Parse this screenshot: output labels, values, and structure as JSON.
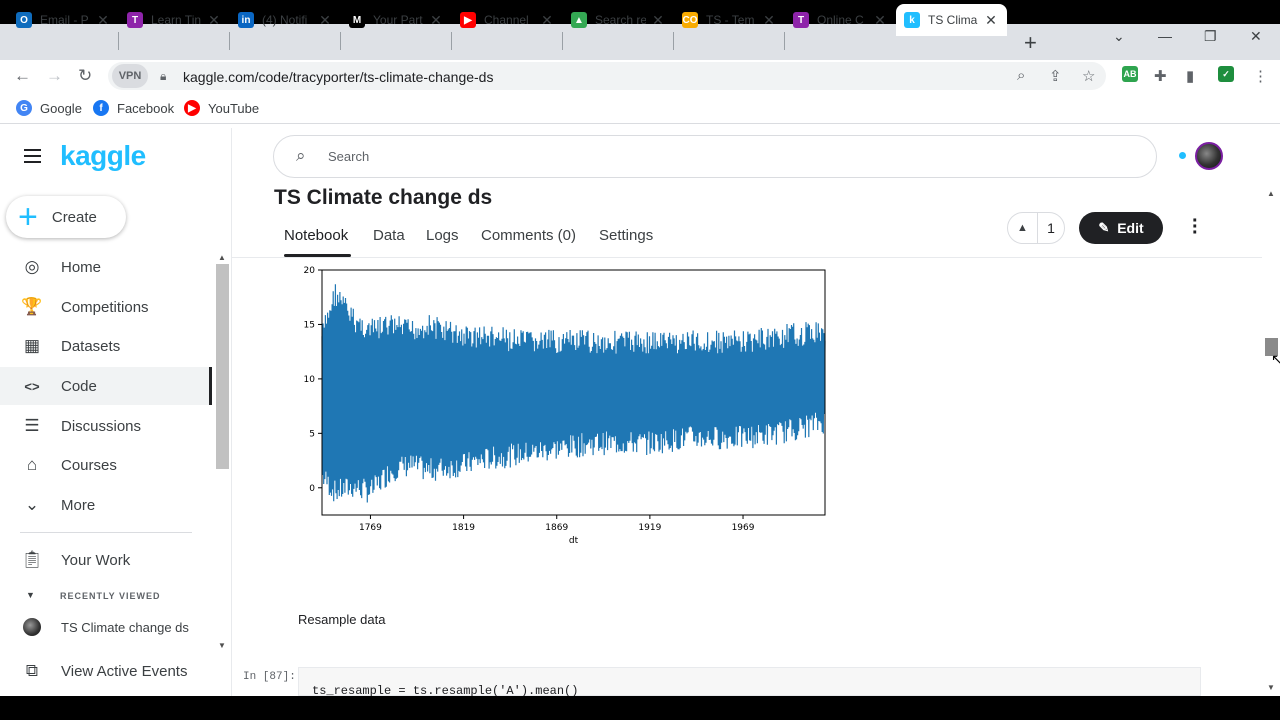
{
  "browser": {
    "tabs": [
      {
        "label": "Email - P",
        "icon": "outlook-icon",
        "color": "#0f6cbd",
        "glyph": "O"
      },
      {
        "label": "Learn Tin",
        "icon": "learn-icon",
        "color": "#8e24aa",
        "glyph": "T"
      },
      {
        "label": "(4) Notifi",
        "icon": "linkedin-icon",
        "color": "#0a66c2",
        "glyph": "in"
      },
      {
        "label": "Your Part",
        "icon": "medium-icon",
        "color": "#000000",
        "glyph": "M"
      },
      {
        "label": "Channel",
        "icon": "youtube-icon",
        "color": "#ff0000",
        "glyph": "▶"
      },
      {
        "label": "Search re",
        "icon": "drive-icon",
        "color": "#34a853",
        "glyph": "▲"
      },
      {
        "label": "TS - Tem",
        "icon": "colab-icon",
        "color": "#f9ab00",
        "glyph": "CO"
      },
      {
        "label": "Online C",
        "icon": "online-icon",
        "color": "#8e24aa",
        "glyph": "T"
      },
      {
        "label": "TS Clima",
        "icon": "kaggle-tab-icon",
        "color": "#20beff",
        "glyph": "k",
        "active": true
      }
    ],
    "url": "kaggle.com/code/tracyporter/ts-climate-change-ds",
    "vpn_label": "VPN",
    "bookmarks": [
      {
        "label": "Google",
        "color": "#4285f4",
        "glyph": "G"
      },
      {
        "label": "Facebook",
        "color": "#1877f2",
        "glyph": "f"
      },
      {
        "label": "YouTube",
        "color": "#ff0000",
        "glyph": "▶"
      }
    ],
    "extensions": [
      {
        "name": "adblock-icon",
        "color": "#2ea44f",
        "glyph": "AB"
      },
      {
        "name": "shield-icon",
        "color": "#1e8e3e",
        "glyph": "✓"
      }
    ]
  },
  "kaggle": {
    "logo": "kaggle",
    "create_label": "Create",
    "nav": [
      {
        "label": "Home",
        "icon": "compass-icon",
        "glyph": "◎"
      },
      {
        "label": "Competitions",
        "icon": "trophy-icon",
        "glyph": "🏆"
      },
      {
        "label": "Datasets",
        "icon": "table-icon",
        "glyph": "▦"
      },
      {
        "label": "Code",
        "icon": "code-icon",
        "glyph": "<>"
      },
      {
        "label": "Discussions",
        "icon": "comments-icon",
        "glyph": "☰"
      },
      {
        "label": "Courses",
        "icon": "school-icon",
        "glyph": "⌂"
      },
      {
        "label": "More",
        "icon": "chevron-down-icon",
        "glyph": "⌄"
      }
    ],
    "your_work": "Your Work",
    "recently_viewed_heading": "RECENTLY VIEWED",
    "recent_item": "TS Climate change ds",
    "view_active_events": "View Active Events",
    "search_placeholder": "Search",
    "notebook_title": "TS Climate change ds",
    "tabs": [
      "Notebook",
      "Data",
      "Logs",
      "Comments (0)",
      "Settings"
    ],
    "vote_count": "1",
    "edit_label": "Edit",
    "markdown_text": "Resample data",
    "cell_prompt": "In [87]:",
    "code_line": "ts_resample = ts.resample('A').mean()"
  },
  "chart_data": {
    "type": "line",
    "xlabel": "dt",
    "ylabel": "",
    "x_ticks": [
      "1769",
      "1819",
      "1869",
      "1919",
      "1969"
    ],
    "y_ticks": [
      0,
      5,
      10,
      15,
      20
    ],
    "xlim": [
      1743,
      2013
    ],
    "ylim": [
      -2.5,
      20
    ],
    "series": [
      {
        "color": "#1f77b4",
        "band": {
          "x": [
            1743,
            1750,
            1760,
            1769,
            1780,
            1790,
            1800,
            1819,
            1830,
            1850,
            1869,
            1890,
            1919,
            1940,
            1969,
            1990,
            2013
          ],
          "upper": [
            15,
            19,
            16.5,
            15.5,
            16,
            15.5,
            16,
            15,
            15,
            14.5,
            14.5,
            14.5,
            14.5,
            14.5,
            14.5,
            15,
            15.5
          ],
          "lower": [
            0,
            -1.5,
            -1,
            -1.5,
            0.5,
            1,
            0.5,
            1,
            1.5,
            2,
            2.5,
            3,
            3,
            3.5,
            3.5,
            4,
            5
          ]
        }
      }
    ]
  }
}
